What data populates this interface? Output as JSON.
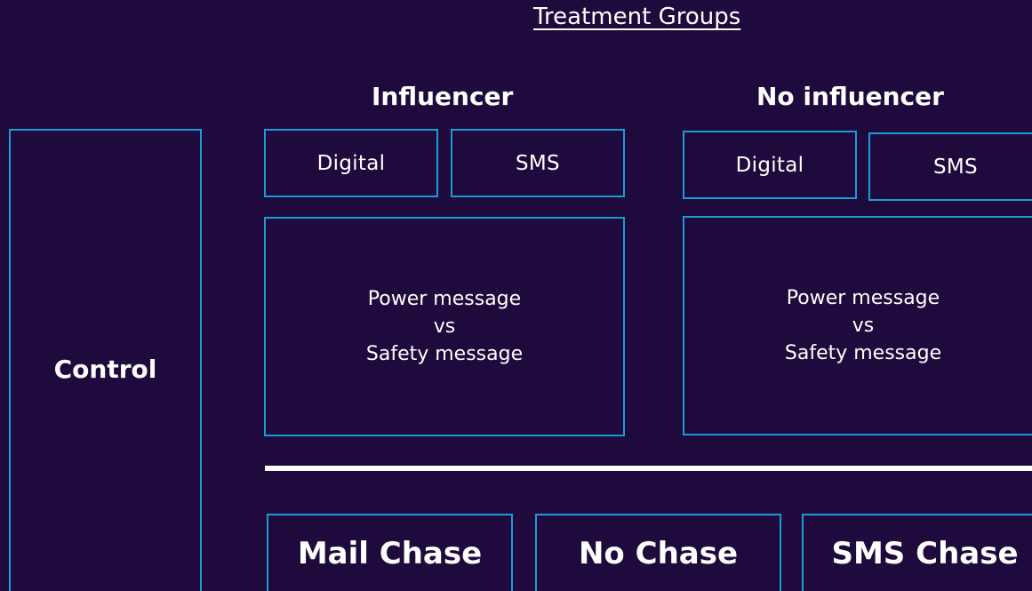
{
  "title": "Treatment Groups",
  "control": {
    "label": "Control"
  },
  "groups": [
    {
      "label": "Influencer",
      "channels": [
        "Digital",
        "SMS"
      ],
      "message": {
        "line1": "Power message",
        "line2": "vs",
        "line3": "Safety message"
      }
    },
    {
      "label": "No influencer",
      "channels": [
        "Digital",
        "SMS"
      ],
      "message": {
        "line1": "Power message",
        "line2": "vs",
        "line3": "Safety message"
      }
    }
  ],
  "chase_options": [
    "Mail Chase",
    "No Chase",
    "SMS Chase"
  ],
  "colors": {
    "background": "#1e0a3c",
    "border": "#1c9bd3",
    "text": "#ffffff",
    "divider": "#ffffff"
  }
}
